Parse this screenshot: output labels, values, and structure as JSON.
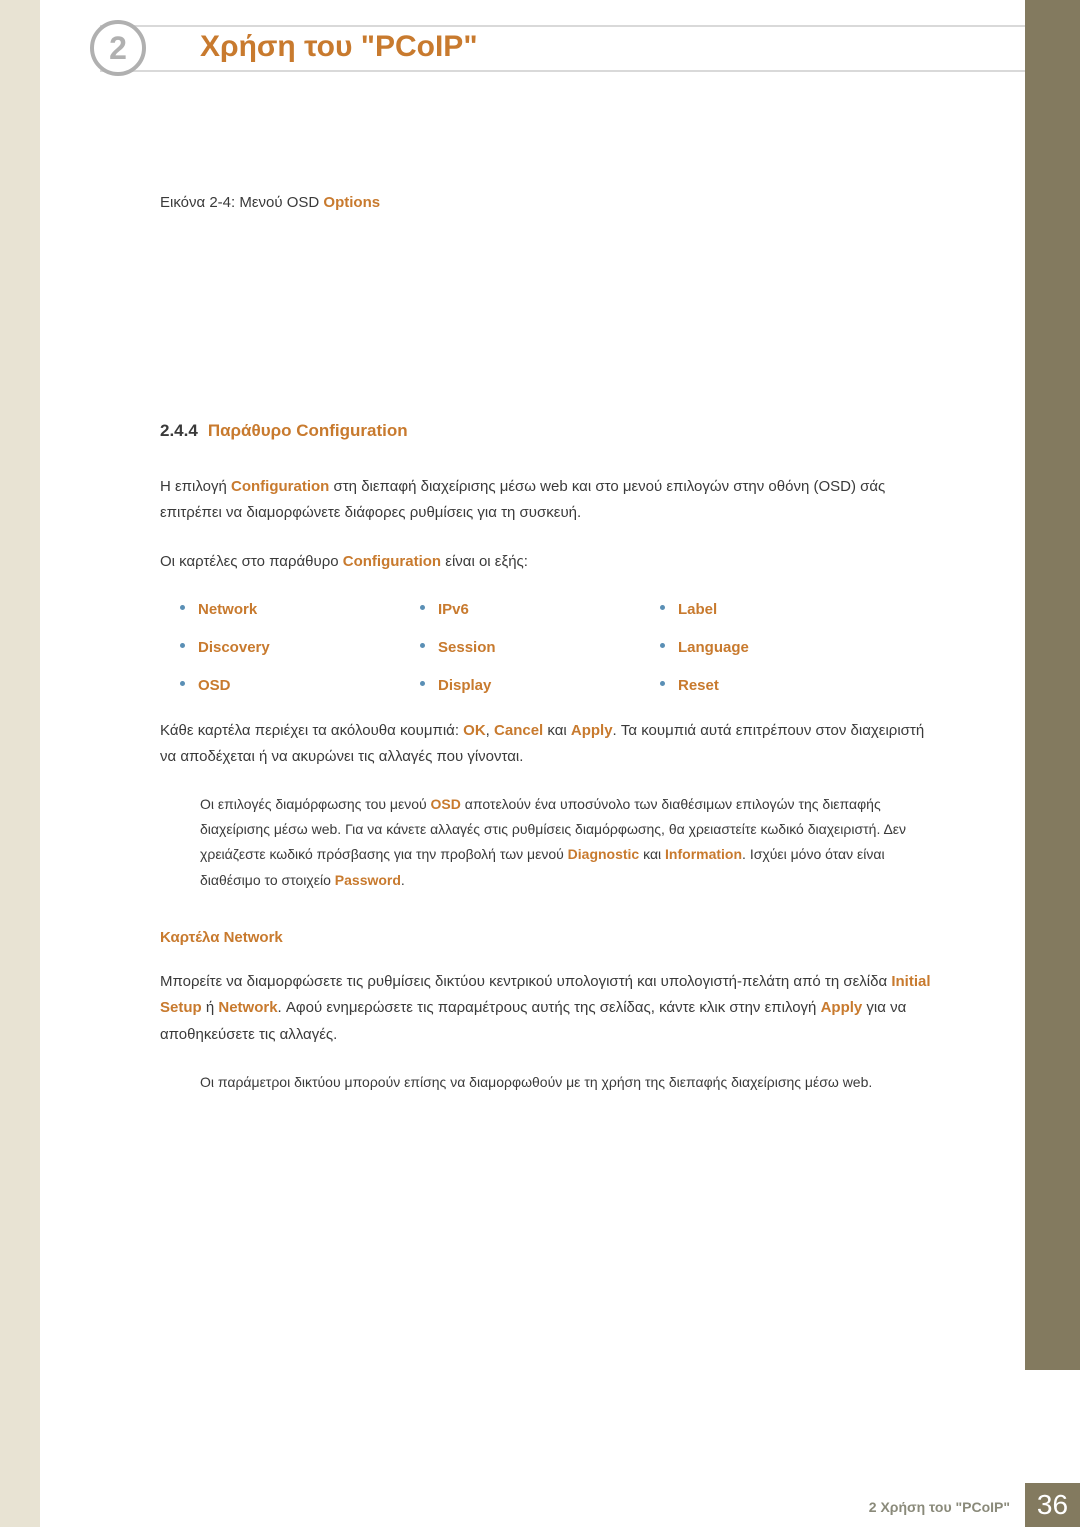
{
  "header": {
    "chapter_number": "2",
    "title": "Χρήση του \"PCoIP\""
  },
  "figure": {
    "prefix": "Εικόνα 2-4: Μενού OSD ",
    "highlight": "Options"
  },
  "section": {
    "number": "2.4.4",
    "title": "Παράθυρο Configuration"
  },
  "intro": {
    "t1": "Η επιλογή ",
    "hl1": "Configuration",
    "t2": " στη διεπαφή διαχείρισης μέσω web και στο μενού επιλογών στην οθόνη (OSD) σάς επιτρέπει να διαμορφώνετε διάφορες ρυθμίσεις για τη συσκευή."
  },
  "tabs_intro": {
    "t1": "Οι καρτέλες στο παράθυρο ",
    "hl1": "Configuration",
    "t2": " είναι οι εξής:"
  },
  "tabs": [
    "Network",
    "IPv6",
    "Label",
    "Discovery",
    "Session",
    "Language",
    "OSD",
    "Display",
    "Reset"
  ],
  "buttons_para": {
    "t1": "Κάθε καρτέλα περιέχει τα ακόλουθα κουμπιά: ",
    "hl1": "OK",
    "sep1": ", ",
    "hl2": "Cancel",
    "t2": " και ",
    "hl3": "Apply",
    "t3": ". Τα κουμπιά αυτά επιτρέπουν στον διαχειριστή να αποδέχεται ή να ακυρώνει τις αλλαγές που γίνονται."
  },
  "note1": {
    "t1": "Οι επιλογές διαμόρφωσης του μενού ",
    "hl1": "OSD",
    "t2": " αποτελούν ένα υποσύνολο των διαθέσιμων επιλογών της διεπαφής διαχείρισης μέσω web. Για να κάνετε αλλαγές στις ρυθμίσεις διαμόρφωσης, θα χρειαστείτε κωδικό διαχειριστή. Δεν χρειάζεστε κωδικό πρόσβασης για την προβολή των μενού ",
    "hl2": "Diagnostic",
    "t3": " και ",
    "hl3": "Information",
    "t4": ". Ισχύει μόνο όταν είναι διαθέσιμο το στοιχείο ",
    "hl4": "Password",
    "t5": "."
  },
  "subsection": {
    "title": "Καρτέλα Network"
  },
  "network_para": {
    "t1": "Μπορείτε να διαμορφώσετε τις ρυθμίσεις δικτύου κεντρικού υπολογιστή και υπολογιστή-πελάτη από τη σελίδα ",
    "hl1": "Initial Setup",
    "t2": " ή ",
    "hl2": "Network",
    "t3": ". Αφού ενημερώσετε τις παραμέτρους αυτής της σελίδας, κάντε κλικ στην επιλογή ",
    "hl3": "Apply",
    "t4": " για να αποθηκεύσετε τις αλλαγές."
  },
  "note2": {
    "text": "Οι παράμετροι δικτύου μπορούν επίσης να διαμορφωθούν με τη χρήση της διεπαφής διαχείρισης μέσω web."
  },
  "footer": {
    "label": "2 Χρήση του \"PCoIP\"",
    "page": "36"
  }
}
